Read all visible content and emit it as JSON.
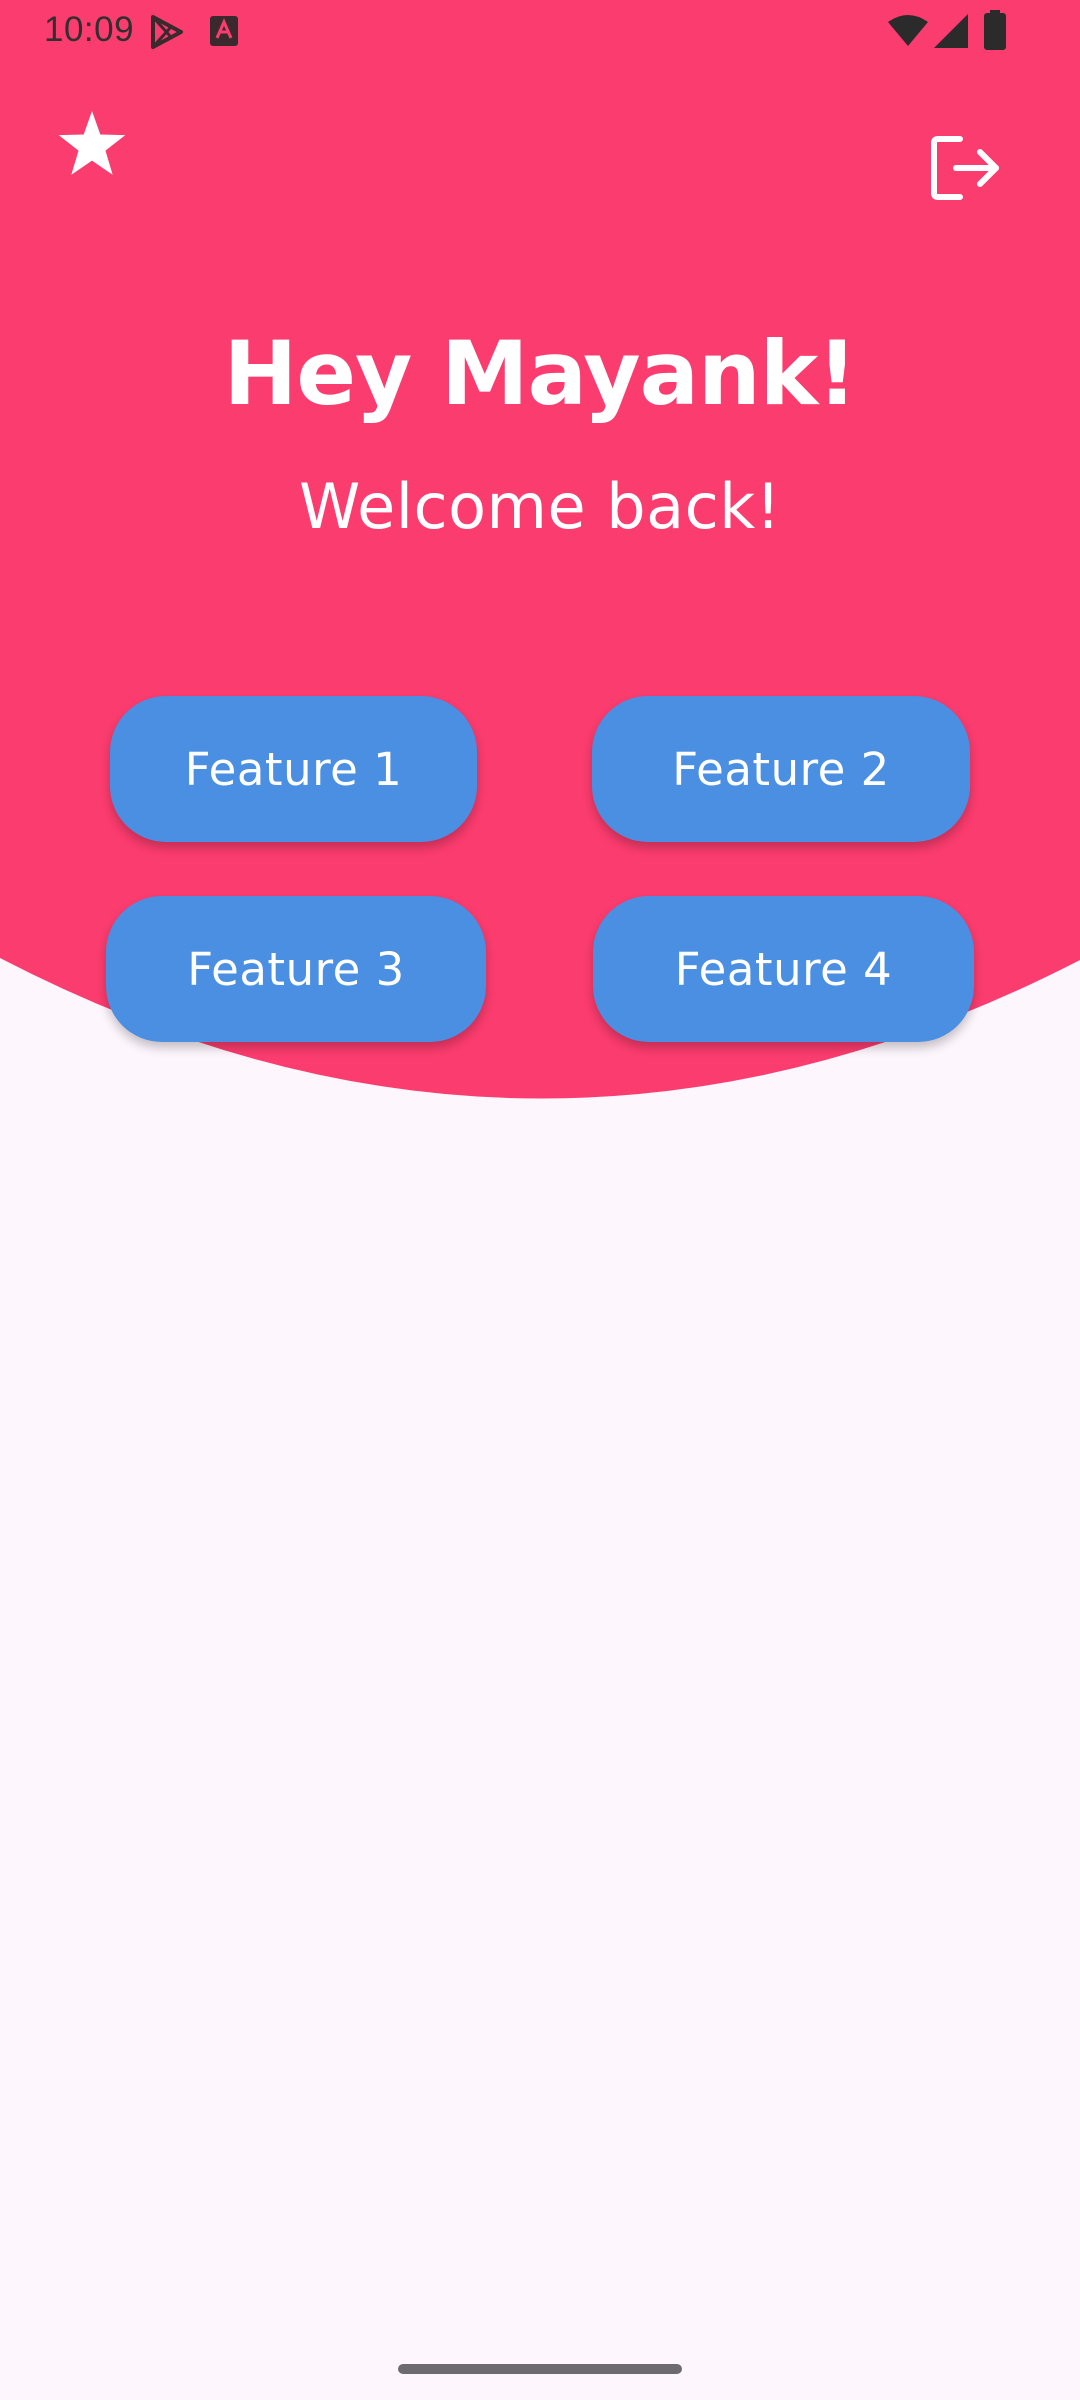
{
  "status_bar": {
    "time": "10:09",
    "icons": [
      "play-store-icon",
      "app-a-icon",
      "wifi-icon",
      "signal-icon",
      "battery-icon"
    ]
  },
  "header": {
    "actions": {
      "left": "star-icon",
      "right": "logout-icon"
    }
  },
  "greeting": {
    "title": "Hey Mayank!",
    "subtitle": "Welcome back!"
  },
  "features": [
    {
      "label": "Feature 1"
    },
    {
      "label": "Feature 2"
    },
    {
      "label": "Feature 3"
    },
    {
      "label": "Feature 4"
    }
  ],
  "colors": {
    "header": "#fb3c6e",
    "button": "#4a8fe2",
    "background": "#fdf6fd",
    "text_on_color": "#ffffff"
  }
}
